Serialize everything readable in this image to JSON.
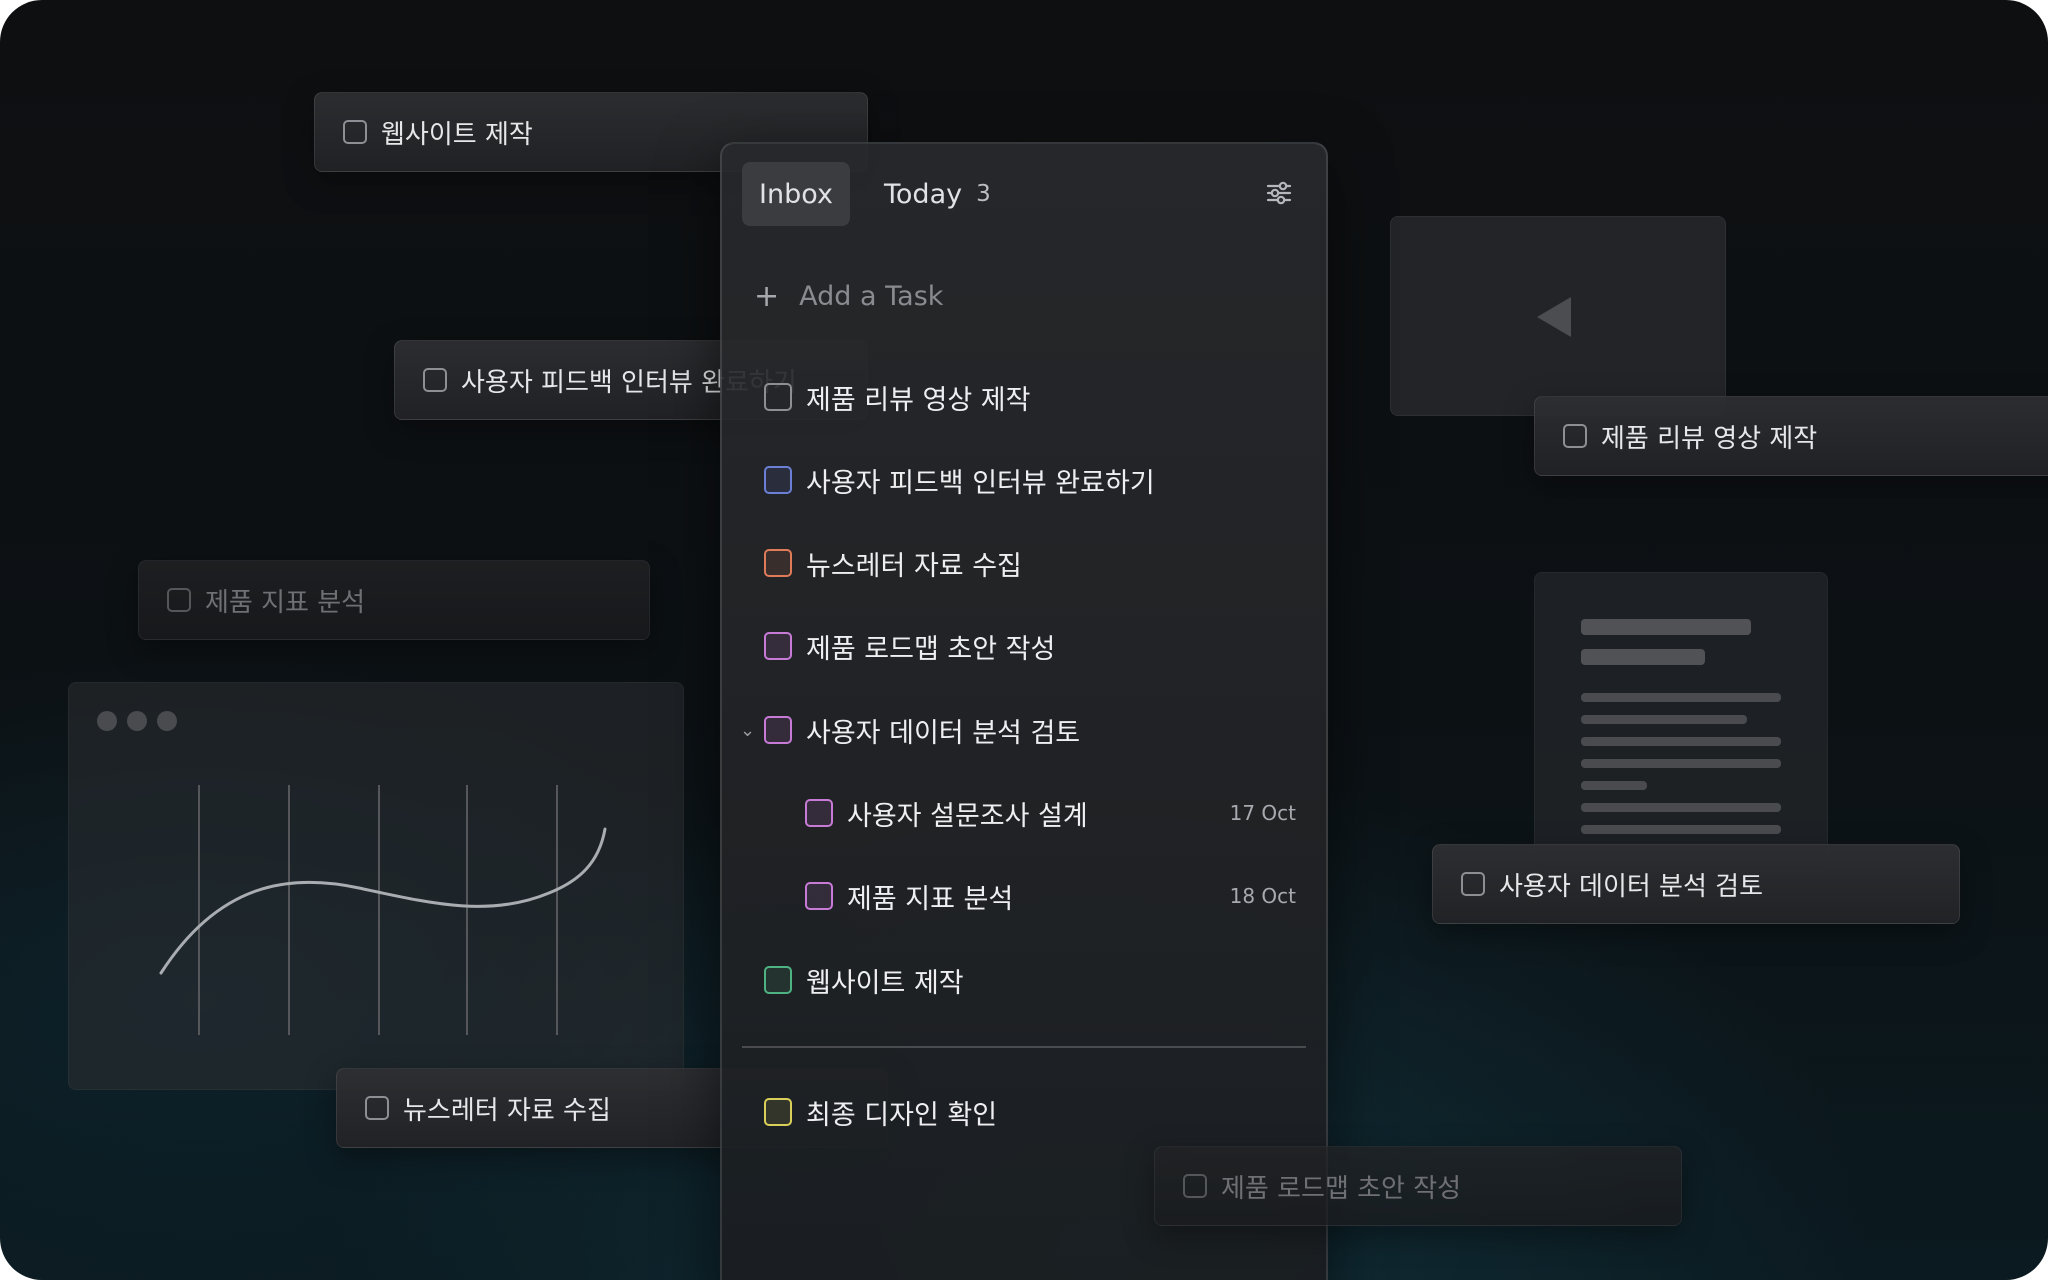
{
  "background_cards": [
    {
      "id": "bg-website",
      "label": "웹사이트 제작"
    },
    {
      "id": "bg-interview",
      "label": "사용자 피드백 인터뷰 완료하기"
    },
    {
      "id": "bg-metrics",
      "label": "제품 지표 분석"
    },
    {
      "id": "bg-newsletter",
      "label": "뉴스레터 자료 수집"
    },
    {
      "id": "bg-review",
      "label": "제품 리뷰 영상 제작"
    },
    {
      "id": "bg-userdata",
      "label": "사용자 데이터 분석 검토"
    },
    {
      "id": "bg-roadmap",
      "label": "제품 로드맵 초안 작성"
    }
  ],
  "panel": {
    "tabs": [
      {
        "label": "Inbox",
        "active": true
      },
      {
        "label": "Today",
        "count": "3",
        "active": false
      }
    ],
    "filter_icon": "sliders-icon",
    "add_task": {
      "icon": "plus-icon",
      "placeholder": "Add a Task"
    },
    "tasks": [
      {
        "label": "제품 리뷰 영상 제작",
        "color": "#8e8f93",
        "level": 0,
        "date": ""
      },
      {
        "label": "사용자 피드백 인터뷰 완료하기",
        "color": "#6b7fd6",
        "level": 0,
        "date": ""
      },
      {
        "label": "뉴스레터 자료 수집",
        "color": "#e07b5a",
        "level": 0,
        "date": ""
      },
      {
        "label": "제품 로드맵 초안 작성",
        "color": "#c77ad6",
        "level": 0,
        "date": ""
      },
      {
        "label": "사용자 데이터 분석 검토",
        "color": "#c77ad6",
        "level": 0,
        "date": "",
        "expanded": true
      },
      {
        "label": "사용자 설문조사 설계",
        "color": "#c77ad6",
        "level": 1,
        "date": "17 Oct"
      },
      {
        "label": "제품 지표 분석",
        "color": "#c77ad6",
        "level": 1,
        "date": "18 Oct"
      },
      {
        "label": "웹사이트 제작",
        "color": "#4fb283",
        "level": 0,
        "date": ""
      }
    ],
    "completed_section": [
      {
        "label": "최종 디자인 확인",
        "color": "#d9cf5a",
        "level": 0
      }
    ]
  },
  "decor": {
    "chart_window": {
      "window_controls": 3,
      "line_color": "#a9adb1"
    },
    "video_window": {
      "icon": "play-back-icon"
    },
    "doc_window": {
      "icon": "document-icon"
    }
  }
}
